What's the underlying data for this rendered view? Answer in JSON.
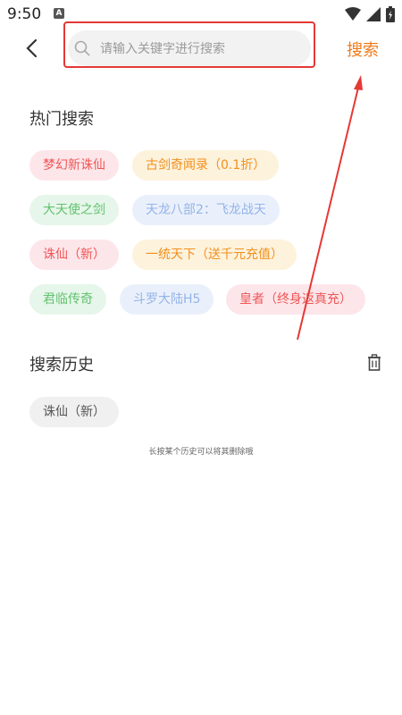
{
  "status_bar": {
    "time": "9:50",
    "notification": "A"
  },
  "header": {
    "search_placeholder": "请输入关键字进行搜索",
    "search_button": "搜索"
  },
  "hot_search": {
    "title": "热门搜索",
    "tags": [
      {
        "label": "梦幻新诛仙"
      },
      {
        "label": "古剑奇闻录（0.1折）"
      },
      {
        "label": "大天使之剑"
      },
      {
        "label": "天龙八部2：飞龙战天"
      },
      {
        "label": "诛仙（新）"
      },
      {
        "label": "一统天下（送千元充值）"
      },
      {
        "label": "君临传奇"
      },
      {
        "label": "斗罗大陆H5"
      },
      {
        "label": "皇者（终身返真充）"
      }
    ]
  },
  "history": {
    "title": "搜索历史",
    "items": [
      {
        "label": "诛仙（新）"
      }
    ],
    "hint": "长按某个历史可以将其删除哦"
  },
  "colors": {
    "accent": "#f07a1a",
    "highlight_box": "#e53935"
  }
}
